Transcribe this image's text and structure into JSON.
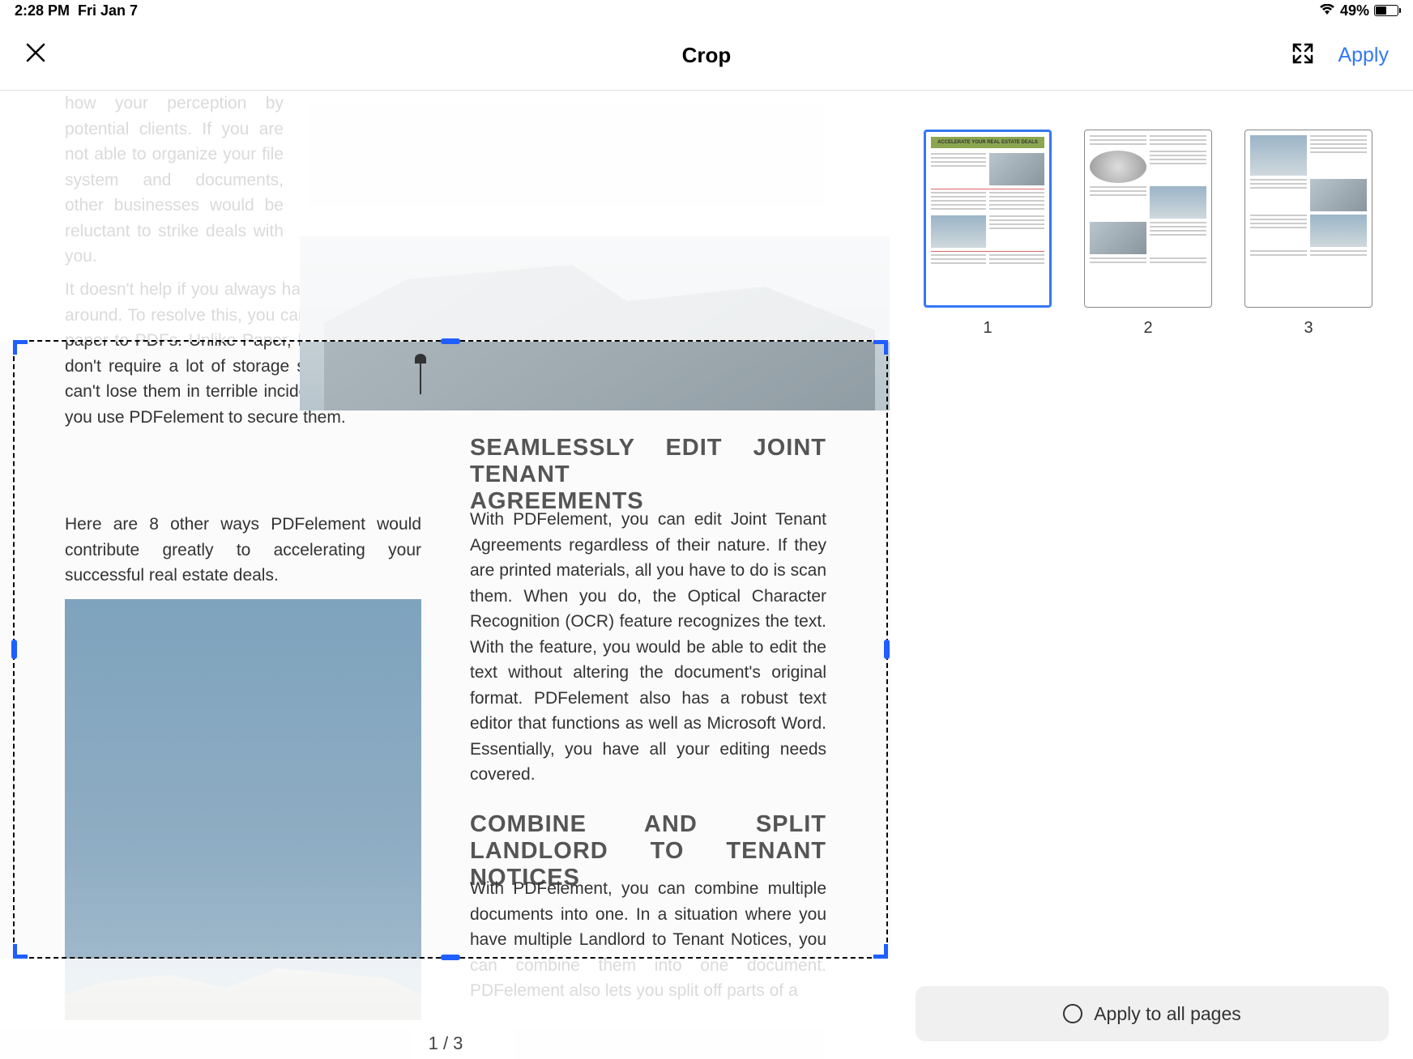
{
  "status": {
    "time": "2:28 PM",
    "date": "Fri Jan 7",
    "battery": "49%"
  },
  "header": {
    "title": "Crop",
    "apply": "Apply"
  },
  "document": {
    "para_top": "how your perception by potential clients. If you are not able to organize your file system and documents, other businesses would be reluctant to strike deals with you.",
    "para1": "It doesn't help if you always have papers flying around. To resolve this, you can transition from paper to PDFs. Unlike Paper, PDF documents don't require a lot of storage space. You also can't lose them in terrible incidents like a fire if you use PDFelement to secure them.",
    "para2": "Here are 8 other ways PDFelement would contribute greatly to accelerating your successful real estate deals.",
    "heading1_a": "SEAMLESSLY EDIT JOINT TENANT",
    "heading1_b": "AGREEMENTS",
    "body1": "With PDFelement, you can edit Joint Tenant Agreements regardless of their nature. If they are printed materials, all you have to do is scan them. When you do, the Optical Character Recognition (OCR) feature recognizes the text. With the feature, you would be able to edit the text without altering the document's original format. PDFelement also has a robust text editor that functions as well as Microsoft Word. Essentially, you have all your editing needs covered.",
    "heading2": "COMBINE AND SPLIT LANDLORD TO TENANT NOTICES",
    "body2": "With PDFelement, you can combine multiple documents into one. In a situation where you have multiple Landlord to Tenant Notices, you can combine them into one document. PDFelement also lets you split off parts of a"
  },
  "thumb1_title": "ACCELERATE YOUR REAL ESTATE DEALS",
  "thumbs": [
    "1",
    "2",
    "3"
  ],
  "page_counter": "1 / 3",
  "apply_all": "Apply to all pages"
}
